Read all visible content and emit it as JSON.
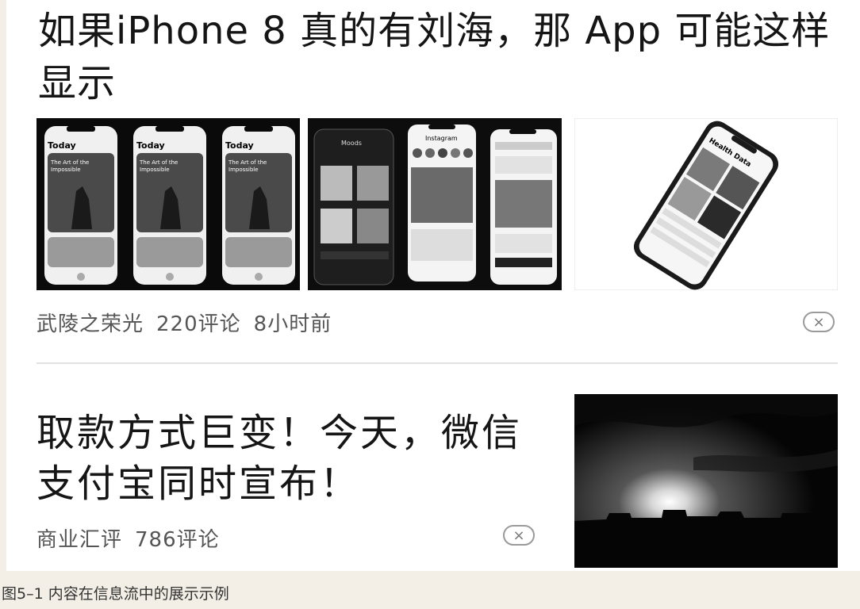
{
  "article1": {
    "title": "如果iPhone 8 真的有刘海，那 App 可能这样显示",
    "source": "武陵之荣光",
    "comments": "220评论",
    "time": "8小时前",
    "close_icon": "×",
    "images": [
      {
        "description": "three-phones-today-app"
      },
      {
        "description": "phones-music-instagram-twitter"
      },
      {
        "description": "phone-health-data"
      }
    ],
    "screen_labels": {
      "today": "Today",
      "art_line1": "The Art of the",
      "art_line2": "Impossible",
      "music": "Moods",
      "instagram": "Instagram",
      "health": "Health Data"
    }
  },
  "article2": {
    "title": "取款方式巨变！今天，微信支付宝同时宣布！",
    "source": "商业汇评",
    "comments": "786评论",
    "close_icon": "×",
    "thumbnail": "sunset-skyline"
  },
  "caption": "图5–1 内容在信息流中的展示示例"
}
